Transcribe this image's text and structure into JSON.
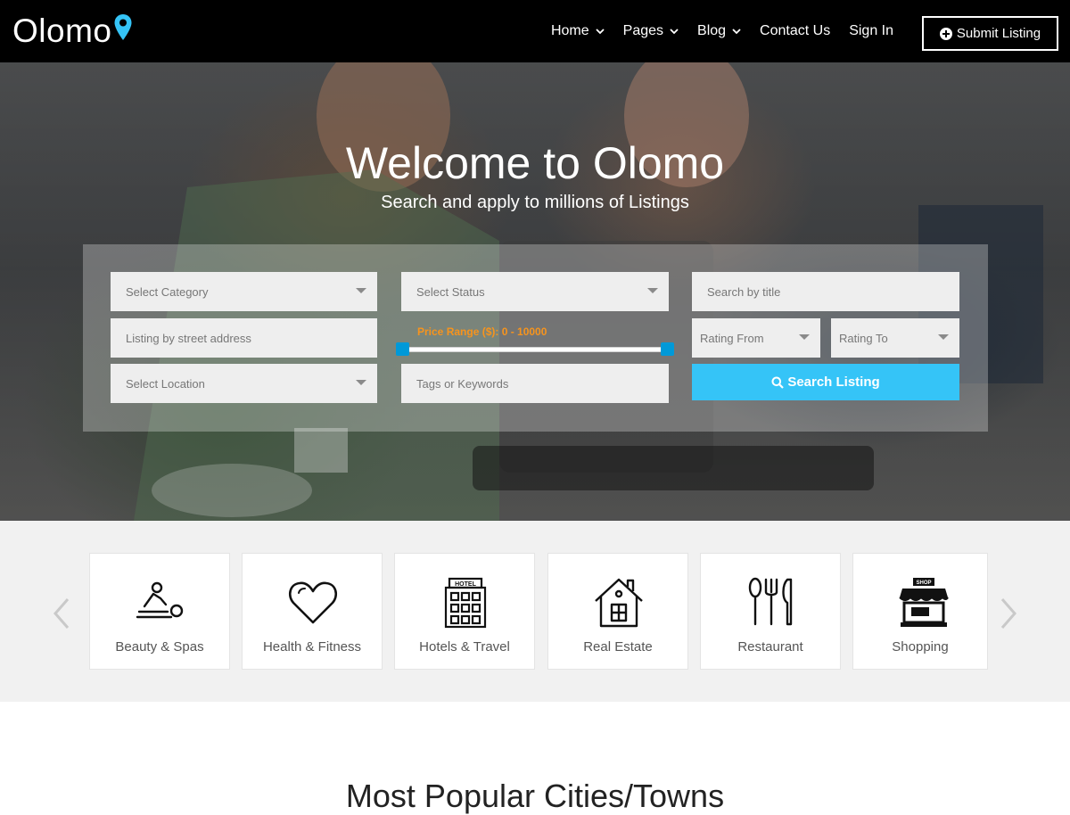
{
  "brand": {
    "name": "Olomo",
    "pin_color": "#35c4f7"
  },
  "nav": {
    "items": [
      {
        "label": "Home",
        "dropdown": true
      },
      {
        "label": "Pages",
        "dropdown": true
      },
      {
        "label": "Blog",
        "dropdown": true
      },
      {
        "label": "Contact Us",
        "dropdown": false
      },
      {
        "label": "Sign In",
        "dropdown": false
      }
    ],
    "submit_label": "Submit Listing",
    "submit_icon": "plus-circle-icon"
  },
  "hero": {
    "title": "Welcome to Olomo",
    "subtitle": "Search and apply to millions of Listings"
  },
  "search": {
    "category_placeholder": "Select Category",
    "status_placeholder": "Select Status",
    "title_placeholder": "Search by title",
    "address_placeholder": "Listing by street address",
    "price_range_label": "Price Range ($): 0 - 10000",
    "price_min": 0,
    "price_max": 10000,
    "rating_from_placeholder": "Rating From",
    "rating_to_placeholder": "Rating To",
    "location_placeholder": "Select Location",
    "tags_placeholder": "Tags or Keywords",
    "search_button_label": "Search Listing",
    "search_icon": "search-icon",
    "button_color": "#35c4f7",
    "price_label_color": "#f7941d"
  },
  "categories": {
    "items": [
      {
        "label": "Beauty & Spas",
        "icon": "massage-icon"
      },
      {
        "label": "Health & Fitness",
        "icon": "heart-icon"
      },
      {
        "label": "Hotels & Travel",
        "icon": "hotel-icon"
      },
      {
        "label": "Real Estate",
        "icon": "house-icon"
      },
      {
        "label": "Restaurant",
        "icon": "cutlery-icon"
      },
      {
        "label": "Shopping",
        "icon": "shop-icon"
      }
    ],
    "hotel_sign": "HOTEL",
    "shop_sign": "SHOP"
  },
  "popular": {
    "heading": "Most Popular Cities/Towns"
  }
}
